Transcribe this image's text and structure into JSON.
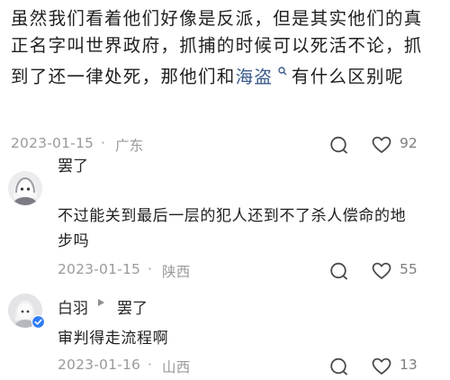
{
  "main_comment": {
    "text_before": "虽然我们看着他们好像是反派，但是其实他们的真正名字叫世界政府，抓捕的时候可以死活不论，抓到了还一律处死，那他们和",
    "link_text": "海盗",
    "text_after": "有什么区别呢",
    "date": "2023-01-15",
    "location": "广东",
    "likes": "92"
  },
  "replies": [
    {
      "username": "罢了",
      "text": "不过能关到最后一层的犯人还到不了杀人偿命的地步吗",
      "date": "2023-01-15",
      "location": "陕西",
      "likes": "55"
    },
    {
      "username": "白羽",
      "reply_to": "罢了",
      "text": "审判得走流程啊",
      "date": "2023-01-16",
      "location": "山西",
      "likes": "13"
    }
  ],
  "separator": "·",
  "icons": {
    "reply": "comment-bubble-icon",
    "like": "heart-outline-icon",
    "link_search": "search-icon",
    "reply_arrow": "triangle-right-icon",
    "verified": "verified-badge-icon"
  },
  "colors": {
    "link": "#3b5a8c",
    "meta": "#9a9a9a",
    "verified": "#2f7df6"
  }
}
